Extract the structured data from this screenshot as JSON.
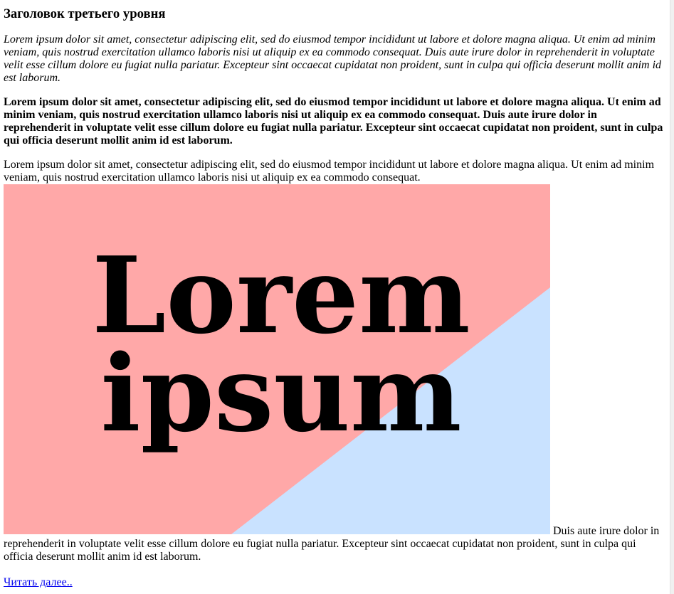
{
  "article": {
    "heading": "Заголовок третьего уровня",
    "paragraph_italic": "Lorem ipsum dolor sit amet, consectetur adipiscing elit, sed do eiusmod tempor incididunt ut labore et dolore magna aliqua. Ut enim ad minim veniam, quis nostrud exercitation ullamco laboris nisi ut aliquip ex ea commodo consequat. Duis aute irure dolor in reprehenderit in voluptate velit esse cillum dolore eu fugiat nulla pariatur. Excepteur sint occaecat cupidatat non proident, sunt in culpa qui officia deserunt mollit anim id est laborum.",
    "paragraph_bold": "Lorem ipsum dolor sit amet, consectetur adipiscing elit, sed do eiusmod tempor incididunt ut labore et dolore magna aliqua. Ut enim ad minim veniam, quis nostrud exercitation ullamco laboris nisi ut aliquip ex ea commodo consequat. Duis aute irure dolor in reprehenderit in voluptate velit esse cillum dolore eu fugiat nulla pariatur. Excepteur sint occaecat cupidatat non proident, sunt in culpa qui officia deserunt mollit anim id est laborum.",
    "paragraph_before_image": "Lorem ipsum dolor sit amet, consectetur adipiscing elit, sed do eiusmod tempor incididunt ut labore et dolore magna aliqua. Ut enim ad minim veniam, quis nostrud exercitation ullamco laboris nisi ut aliquip ex ea commodo consequat.",
    "paragraph_after_image": " Duis aute irure dolor in reprehenderit in voluptate velit esse cillum dolore eu fugiat nulla pariatur. Excepteur sint occaecat cupidatat non proident, sunt in culpa qui officia deserunt mollit anim id est laborum.",
    "read_more": "Читать далее.."
  },
  "hero_image": {
    "line1": "Lorem",
    "line2": "ipsum",
    "colors": {
      "pink": "#ffa8a8",
      "blue": "#c9e2ff",
      "text": "#000000"
    }
  }
}
